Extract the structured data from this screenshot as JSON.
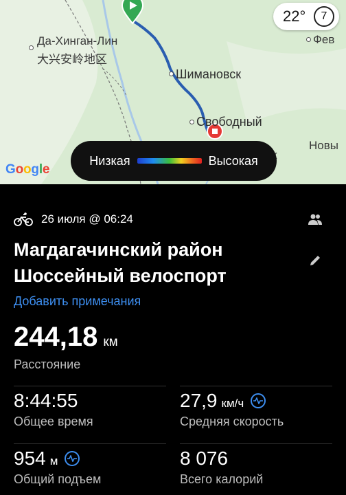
{
  "map": {
    "labels": {
      "region": "Да-Хинган-Лин",
      "region_cn": "大兴安岭地区",
      "city1": "Шимановск",
      "city2": "Свободный",
      "east1": "Фев",
      "east2": "Новы",
      "partial": "к"
    },
    "google": "Google",
    "weather": {
      "temp": "22°",
      "wind": "7"
    },
    "legend": {
      "low": "Низкая",
      "high": "Высокая"
    },
    "colors": {
      "route": "#2a5db0",
      "start": "#34a853",
      "end": "#e53935"
    }
  },
  "activity": {
    "date": "26 июля @ 06:24",
    "title_line1": "Магдагачинский район",
    "title_line2": "Шоссейный велоспорт",
    "add_notes": "Добавить примечания",
    "distance": {
      "value": "244,18",
      "unit": "км",
      "label": "Расстояние"
    },
    "total_time": {
      "value": "8:44:55",
      "label": "Общее время"
    },
    "avg_speed": {
      "value": "27,9",
      "unit": "км/ч",
      "label": "Средняя скорость"
    },
    "elevation": {
      "value": "954",
      "unit": "м",
      "label": "Общий подъем"
    },
    "calories": {
      "value": "8 076",
      "label": "Всего калорий"
    }
  }
}
